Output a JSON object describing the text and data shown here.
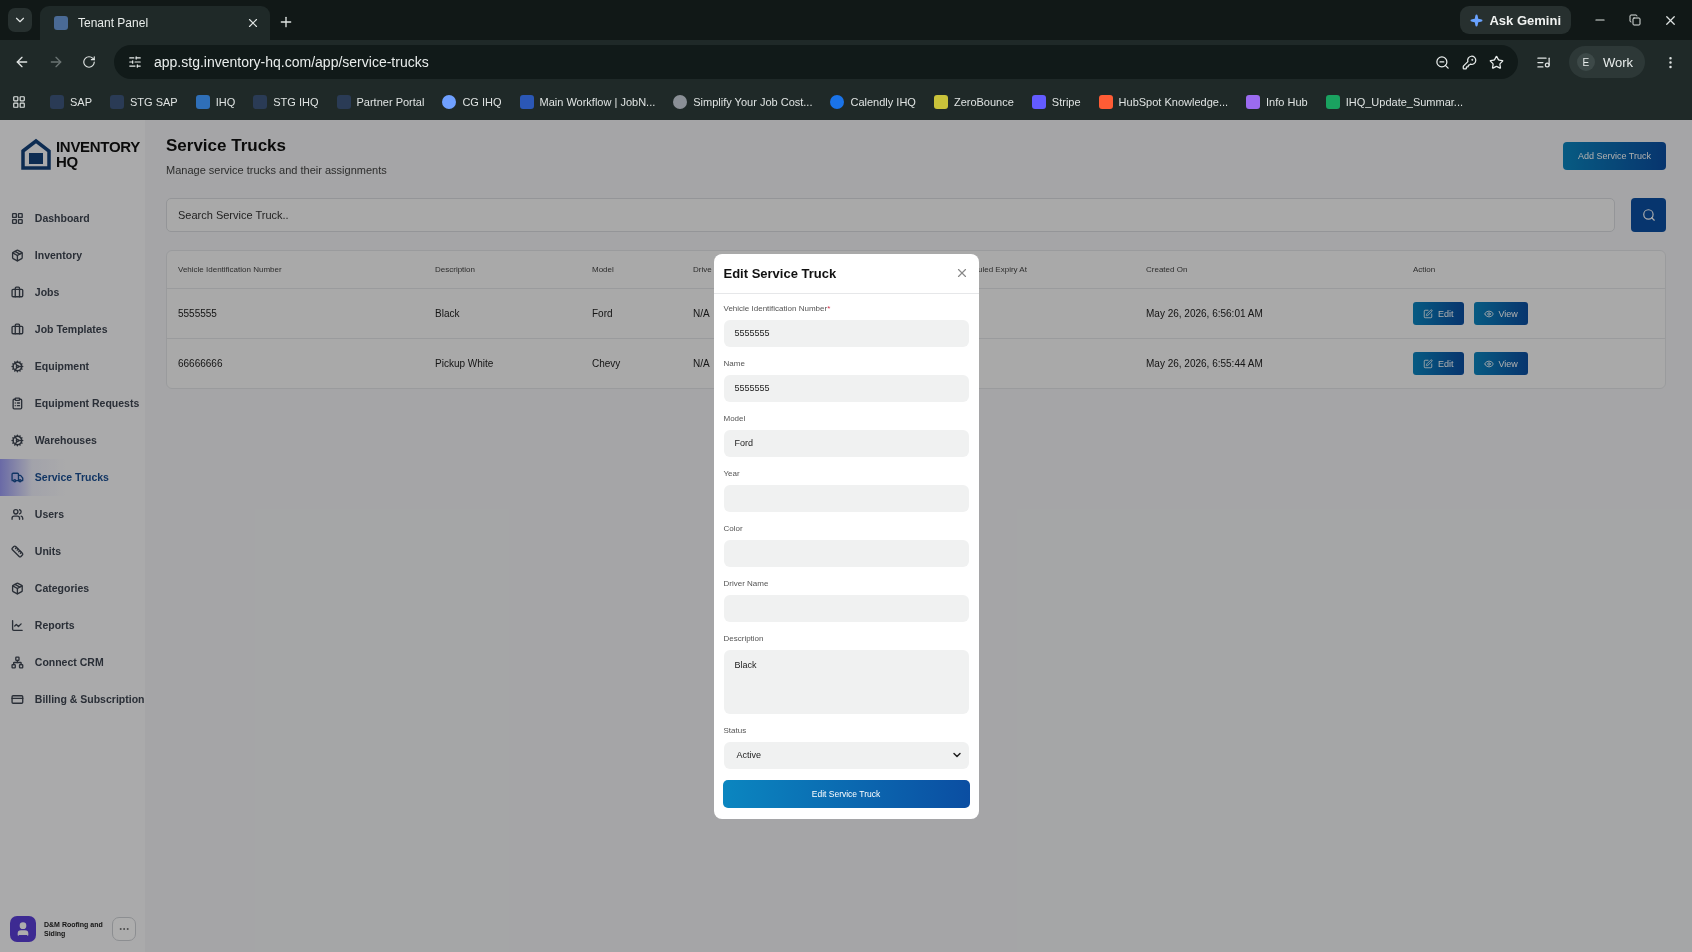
{
  "browser": {
    "tab_title": "Tenant Panel",
    "url": "app.stg.inventory-hq.com/app/service-trucks",
    "ask_gemini": "Ask Gemini",
    "profile_initial": "E",
    "profile_name": "Work",
    "bookmarks": [
      "SAP",
      "STG SAP",
      "IHQ",
      "STG IHQ",
      "Partner Portal",
      "CG IHQ",
      "Main Workflow | JobN...",
      "Simplify Your Job Cost...",
      "Calendly IHQ",
      "ZeroBounce",
      "Stripe",
      "HubSpot Knowledge...",
      "Info Hub",
      "IHQ_Update_Summar..."
    ]
  },
  "sidebar": {
    "logo_line1": "INVENTORY",
    "logo_line2": "HQ",
    "items": [
      {
        "label": "Dashboard",
        "selected": false
      },
      {
        "label": "Inventory",
        "selected": false
      },
      {
        "label": "Jobs",
        "selected": false
      },
      {
        "label": "Job Templates",
        "selected": false
      },
      {
        "label": "Equipment",
        "selected": false
      },
      {
        "label": "Equipment Requests",
        "selected": false
      },
      {
        "label": "Warehouses",
        "selected": false
      },
      {
        "label": "Service Trucks",
        "selected": true
      },
      {
        "label": "Users",
        "selected": false
      },
      {
        "label": "Units",
        "selected": false
      },
      {
        "label": "Categories",
        "selected": false
      },
      {
        "label": "Reports",
        "selected": false
      },
      {
        "label": "Connect CRM",
        "selected": false
      },
      {
        "label": "Billing & Subscription",
        "selected": false
      }
    ],
    "account": {
      "name": "D&M Roofing and Siding"
    }
  },
  "page": {
    "title": "Service Trucks",
    "subtitle": "Manage service trucks and their assignments",
    "add_button": "Add Service Truck",
    "search": {
      "placeholder": "Search Service Truck.."
    }
  },
  "table": {
    "columns": [
      "Vehicle Identification Number",
      "Description",
      "Model",
      "Drive",
      "uled Expiry At",
      "Created On",
      "Action"
    ],
    "rows": [
      {
        "vin": "5555555",
        "description": "Black",
        "model": "Ford",
        "driver": "N/A",
        "created_on": "May 26, 2026, 6:56:01 AM",
        "actions": [
          "Edit",
          "View"
        ]
      },
      {
        "vin": "66666666",
        "description": "Pickup White",
        "model": "Chevy",
        "driver": "N/A",
        "created_on": "May 26, 2026, 6:55:44 AM",
        "actions": [
          "Edit",
          "View"
        ]
      }
    ]
  },
  "modal": {
    "title": "Edit Service Truck",
    "submit": "Edit Service Truck",
    "fields": [
      {
        "kind": "text",
        "label": "Vehicle Identification Number",
        "required_mark": "*",
        "value": "5555555"
      },
      {
        "kind": "text",
        "label": "Name",
        "value": "5555555"
      },
      {
        "kind": "text",
        "label": "Model",
        "value": "Ford"
      },
      {
        "kind": "text",
        "label": "Year"
      },
      {
        "kind": "text",
        "label": "Color"
      },
      {
        "kind": "text",
        "label": "Driver Name"
      },
      {
        "kind": "textarea",
        "label": "Description",
        "value": "Black"
      },
      {
        "kind": "select",
        "label": "Status",
        "value": "Active"
      }
    ]
  }
}
